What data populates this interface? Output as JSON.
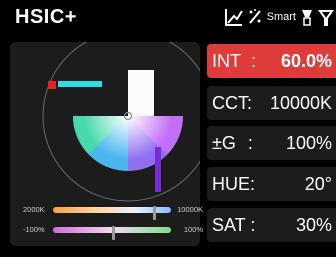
{
  "header": {
    "title": "HSIC+",
    "smart_label": "Smart",
    "icons": [
      "curve-icon",
      "effect-icon",
      "smart-icon",
      "bulb-icon",
      "bulb-outline-icon"
    ]
  },
  "wheel": {
    "cct_slider": {
      "min_label": "2000K",
      "max_label": "10000K",
      "position": 0.85
    },
    "green_slider": {
      "min_label": "-100%",
      "max_label": "100%",
      "position": 0.5
    }
  },
  "params": {
    "int": {
      "label": "INT",
      "sep": ":",
      "value": "60.0%"
    },
    "cct": {
      "label": "CCT:",
      "value": "10000K"
    },
    "g": {
      "label": "±G",
      "sep": ":",
      "value": "100%"
    },
    "hue": {
      "label": "HUE:",
      "value": "20°"
    },
    "sat": {
      "label": "SAT :",
      "value": "30%"
    }
  },
  "colors": {
    "accent": "#de3b3b",
    "panel": "#1c1c1c",
    "marker_red": "#e82222",
    "marker_cyan": "#2bdde0",
    "marker_purple": "#7a2bd8"
  }
}
